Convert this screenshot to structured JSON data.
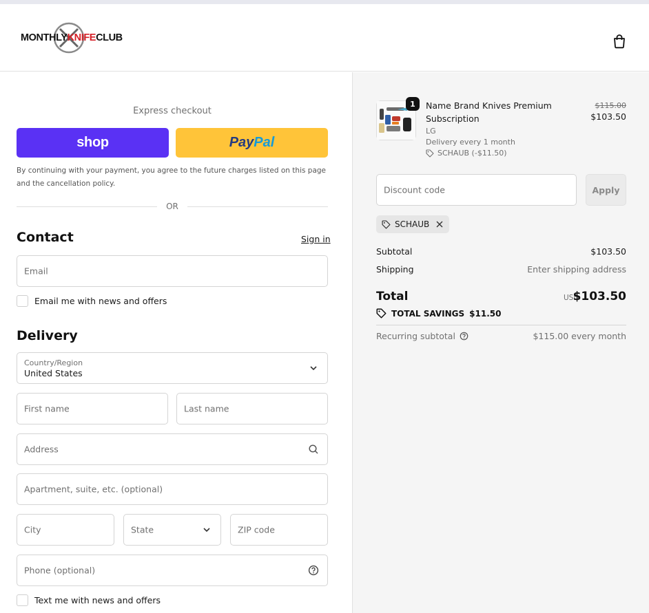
{
  "header": {
    "logo": {
      "part1": "MONTHLY",
      "part2": "KNIFE",
      "part3": "CLUB"
    }
  },
  "express": {
    "label": "Express checkout",
    "shop_label": "shop",
    "paypal_part1": "Pay",
    "paypal_part2": "Pal",
    "consent": "By continuing with your payment, you agree to the future charges listed on this page and the cancellation policy.",
    "or": "OR"
  },
  "contact": {
    "title": "Contact",
    "sign_in": "Sign in",
    "email_placeholder": "Email",
    "email_opt_in": "Email me with news and offers"
  },
  "delivery": {
    "title": "Delivery",
    "country_label": "Country/Region",
    "country_value": "United States",
    "first_name": "First name",
    "last_name": "Last name",
    "address": "Address",
    "apartment": "Apartment, suite, etc. (optional)",
    "city": "City",
    "state": "State",
    "zip": "ZIP code",
    "phone": "Phone (optional)",
    "sms_opt_in": "Text me with news and offers"
  },
  "summary": {
    "item": {
      "quantity": "1",
      "name": "Name Brand Knives Premium Subscription",
      "variant": "LG",
      "frequency": "Delivery every 1 month",
      "discount": "SCHAUB (-$11.50)",
      "original_price": "$115.00",
      "price": "$103.50"
    },
    "discount_placeholder": "Discount code",
    "apply_label": "Apply",
    "applied_code": "SCHAUB",
    "subtotal_label": "Subtotal",
    "subtotal_value": "$103.50",
    "shipping_label": "Shipping",
    "shipping_value": "Enter shipping address",
    "total_label": "Total",
    "currency": "USD",
    "total_value": "$103.50",
    "savings_label": "TOTAL SAVINGS",
    "savings_value": "$11.50",
    "recurring_label": "Recurring subtotal",
    "recurring_value": "$115.00 every month"
  },
  "colors": {
    "shop": "#5a31f4",
    "paypal": "#ffc439",
    "paypal_dark": "#253b80",
    "paypal_light": "#179bd7",
    "brand_red": "#d61f26"
  }
}
